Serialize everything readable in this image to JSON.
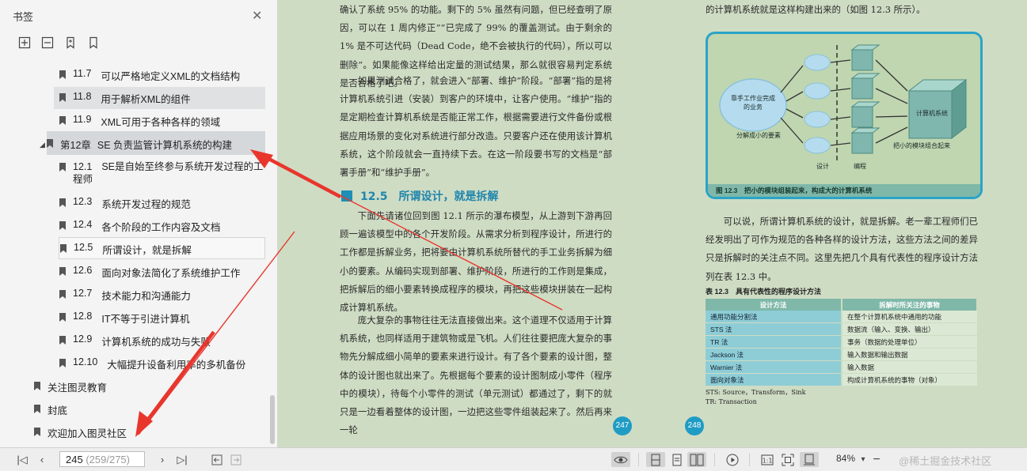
{
  "sidebar": {
    "title": "书签",
    "items": [
      {
        "num": "11.7",
        "label": "可以严格地定义XML的文档结构"
      },
      {
        "num": "11.8",
        "label": "用于解析XML的组件"
      },
      {
        "num": "11.9",
        "label": "XML可用于各种各样的领域"
      },
      {
        "num": "第12章",
        "label": "SE 负责监管计算机系统的构建"
      },
      {
        "num": "12.1",
        "label": "SE是自始至终参与系统开发过程的工",
        "label2": "程师"
      },
      {
        "num": "12.3",
        "label": "系统开发过程的规范"
      },
      {
        "num": "12.4",
        "label": "各个阶段的工作内容及文档"
      },
      {
        "num": "12.5",
        "label": "所谓设计，就是拆解"
      },
      {
        "num": "12.6",
        "label": "面向对象法简化了系统维护工作"
      },
      {
        "num": "12.7",
        "label": "技术能力和沟通能力"
      },
      {
        "num": "12.8",
        "label": "IT不等于引进计算机"
      },
      {
        "num": "12.9",
        "label": "计算机系统的成功与失败"
      },
      {
        "num": "12.10",
        "label": "大幅提升设备利用率的多机备份"
      },
      {
        "num": "",
        "label": "关注图灵教育"
      },
      {
        "num": "",
        "label": "封底"
      },
      {
        "num": "",
        "label": "欢迎加入图灵社区"
      }
    ]
  },
  "page_left": {
    "para1": "确认了系统 95% 的功能。剩下的 5% 虽然有问题，但已经查明了原因，可以在 1 周内修正”“已完成了 99% 的覆盖测试。由于剩余的 1% 是不可达代码（Dead Code，绝不会被执行的代码），所以可以删除”。如果能像这样给出定量的测试结果，那么就很容易判定系统是否合格了吧。",
    "para2": "如果测试合格了，就会进入“部署、维护”阶段。“部署”指的是将计算机系统引进（安装）到客户的环境中，让客户使用。“维护”指的是定期检查计算机系统是否能正常工作，根据需要进行文件备份或根据应用场景的变化对系统进行部分改造。只要客户还在使用该计算机系统，这个阶段就会一直持续下去。在这一阶段要书写的文档是“部署手册”和“维护手册”。",
    "section_title": "12.5　所谓设计，就是拆解",
    "para3": "下面先请诸位回到图 12.1 所示的瀑布模型，从上游到下游再回顾一遍该模型中的各个开发阶段。从需求分析到程序设计，所进行的工作都是拆解业务，把将要由计算机系统所替代的手工业务拆解为细小的要素。从编码实现到部署、维护阶段，所进行的工作则是集成，把拆解后的细小要素转换成程序的模块，再把这些模块拼装在一起构成计算机系统。",
    "para4": "庞大复杂的事物往往无法直接做出来。这个道理不仅适用于计算机系统，也同样适用于建筑物或是飞机。人们往往要把庞大复杂的事物先分解成细小简单的要素来进行设计。有了各个要素的设计图，整体的设计图也就出来了。先根据每个要素的设计图制成小零件（程序中的模块），待每个小零件的测试（单元测试）都通过了，剩下的就只是一边看着整体的设计图，一边把这些零件组装起来了。然后再来一轮",
    "page_number": "247"
  },
  "page_right": {
    "para1": "的计算机系统就是这样构建出来的（如图 12.3 所示）。",
    "figure": {
      "left_bubble": "靠手工作业完成的业务",
      "right_box": "计算机系统",
      "small_elements_label": "分解成小的要素",
      "assemble_label": "把小的模块组合起来",
      "design_label": "设计",
      "coding_label": "编程",
      "caption": "图 12.3　把小的模块组装起来，构成大的计算机系统"
    },
    "para2": "可以说，所谓计算机系统的设计，就是拆解。老一辈工程师们已经发明出了可作为规范的各种各样的设计方法，这些方法之间的差异只是拆解时的关注点不同。这里先把几个具有代表性的程序设计方法列在表 12.3 中。",
    "table": {
      "caption": "表 12.3　具有代表性的程序设计方法",
      "headers": [
        "设计方法",
        "拆解时所关注的事物"
      ],
      "rows": [
        [
          "通用功能分割法",
          "在整个计算机系统中通用的功能"
        ],
        [
          "STS 法",
          "数据流（输入、变换、输出）"
        ],
        [
          "TR 法",
          "事务（数据的处理单位）"
        ],
        [
          "Jackson 法",
          "输入数据和输出数据"
        ],
        [
          "Warnier 法",
          "输入数据"
        ],
        [
          "面向对象法",
          "构成计算机系统的事物（对象）"
        ]
      ],
      "note1": "STS: Source，Transform，Sink",
      "note2": "TR: Transaction"
    },
    "page_number": "248"
  },
  "bottombar": {
    "page_current": "245",
    "page_total": "(259/275)",
    "zoom": "84%",
    "watermark": "@稀土掘金技术社区"
  }
}
